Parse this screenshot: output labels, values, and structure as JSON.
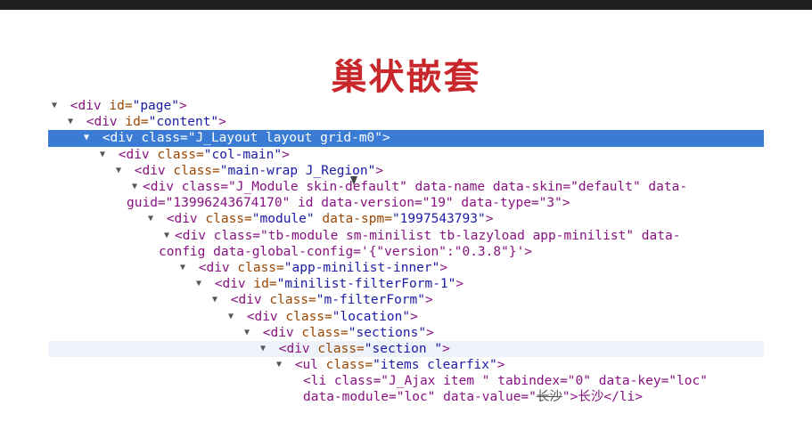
{
  "title": "巢状嵌套",
  "tree": {
    "n1": {
      "tag": "<div",
      "attr": "id=",
      "val": "\"page\"",
      "end": ">"
    },
    "n2": {
      "tag": "<div",
      "attr": "id=",
      "val": "\"content\"",
      "end": ">"
    },
    "n3": {
      "text": "<div class=\"J_Layout layout grid-m0\">"
    },
    "n4": {
      "tag": "<div",
      "attr": "class=",
      "val": "\"col-main\"",
      "end": ">"
    },
    "n5": {
      "tag": "<div",
      "attr": "class=",
      "val": "\"main-wrap J_Region\"",
      "end": ">"
    },
    "n6": {
      "line1": "<div class=\"J_Module skin-default\" data-name data-skin=\"default\" data-",
      "line2": "guid=\"13996243674170\" id data-version=\"19\" data-type=\"3\">"
    },
    "n7": {
      "tag": "<div",
      "attr": "class=",
      "val": "\"module\"",
      "attr2": "data-spm=",
      "val2": "\"1997543793\"",
      "end": ">"
    },
    "n8": {
      "line1": "<div class=\"tb-module sm-minilist tb-lazyload app-minilist\" data-",
      "line2": "config data-global-config='{\"version\":\"0.3.8\"}'>"
    },
    "n9": {
      "tag": "<div",
      "attr": "class=",
      "val": "\"app-minilist-inner\"",
      "end": ">"
    },
    "n10": {
      "tag": "<div",
      "attr": "id=",
      "val": "\"minilist-filterForm-1\"",
      "end": ">"
    },
    "n11": {
      "tag": "<div",
      "attr": "class=",
      "val": "\"m-filterForm\"",
      "end": ">"
    },
    "n12": {
      "tag": "<div",
      "attr": "class=",
      "val": "\"location\"",
      "end": ">"
    },
    "n13": {
      "tag": "<div",
      "attr": "class=",
      "val": "\"sections\"",
      "end": ">"
    },
    "n14": {
      "tag": "<div",
      "attr": "class=",
      "val": "\"section \"",
      "end": ">"
    },
    "n15": {
      "tag": "<ul",
      "attr": "class=",
      "val": "\"items clearfix\"",
      "end": ">"
    },
    "n16": {
      "line1": "<li class=\"J_Ajax item \" tabindex=\"0\" data-key=\"loc\"",
      "line2a": "data-module=\"loc\" data-value=\"",
      "strike": "长沙",
      "line2b": "\">长沙</li>"
    }
  },
  "toggle_glyph": "▼"
}
